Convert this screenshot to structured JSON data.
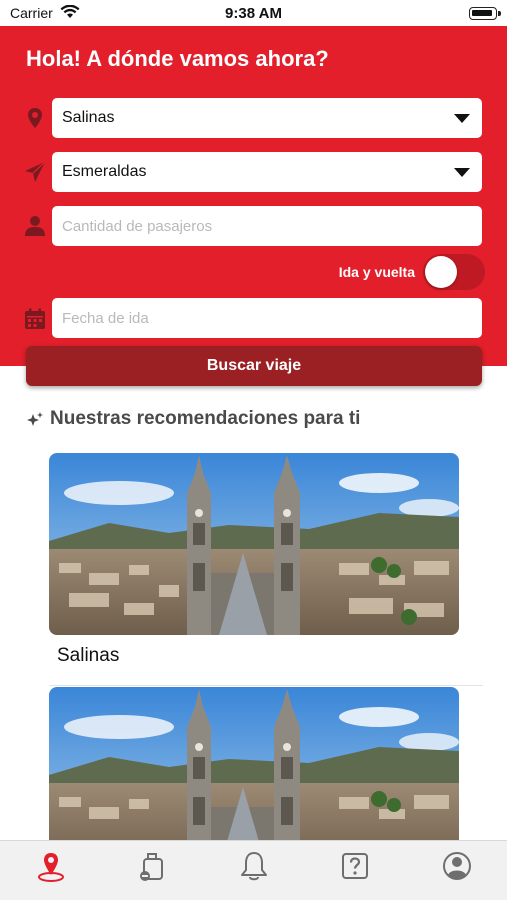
{
  "status_bar": {
    "carrier": "Carrier",
    "time": "9:38 AM"
  },
  "header": {
    "title": "Hola! A dónde vamos ahora?"
  },
  "form": {
    "origin": {
      "value": "Salinas",
      "icon": "location-pin-icon"
    },
    "destination": {
      "value": "Esmeraldas",
      "icon": "paper-plane-icon"
    },
    "passengers": {
      "placeholder": "Cantidad de pasajeros",
      "icon": "person-icon"
    },
    "round_trip": {
      "label": "Ida y vuelta",
      "enabled": false
    },
    "departure_date": {
      "placeholder": "Fecha de ida",
      "icon": "calendar-icon"
    },
    "search_button": "Buscar viaje"
  },
  "recommendations": {
    "title": "Nuestras recomendaciones para ti",
    "icon": "sparkle-icon",
    "items": [
      {
        "name": "Salinas"
      },
      {
        "name": ""
      }
    ]
  },
  "tab_bar": {
    "items": [
      {
        "icon": "map-pin-icon",
        "active": true
      },
      {
        "icon": "luggage-icon",
        "active": false
      },
      {
        "icon": "bell-icon",
        "active": false
      },
      {
        "icon": "help-icon",
        "active": false
      },
      {
        "icon": "profile-icon",
        "active": false
      }
    ]
  },
  "colors": {
    "brand_red": "#e21f2b",
    "button_dark_red": "#9b2023",
    "active_tab": "#e21f2b",
    "inactive_tab": "#6e6e6e"
  }
}
